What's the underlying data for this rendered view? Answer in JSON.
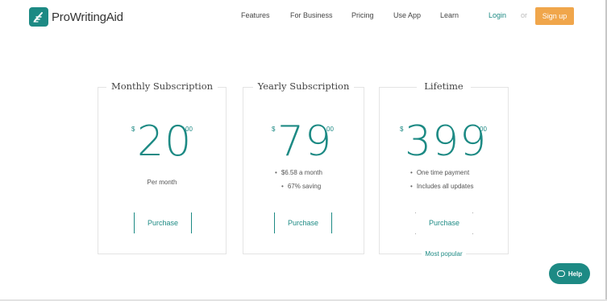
{
  "header": {
    "brand": "ProWritingAid",
    "nav": [
      "Features",
      "For Business",
      "Pricing",
      "Use App",
      "Learn"
    ],
    "login": "Login",
    "or": "or",
    "signup": "Sign up"
  },
  "plans": [
    {
      "title": "Monthly Subscription",
      "currency": "$",
      "amount": "20",
      "cents": "00",
      "per": "Per month",
      "bullets": [],
      "purchase": "Purchase",
      "badge": ""
    },
    {
      "title": "Yearly Subscription",
      "currency": "$",
      "amount": "79",
      "cents": "00",
      "per": "",
      "bullets": [
        "$6.58 a month",
        "67% saving"
      ],
      "purchase": "Purchase",
      "badge": ""
    },
    {
      "title": "Lifetime",
      "currency": "$",
      "amount": "399",
      "cents": "00",
      "per": "",
      "bullets": [
        "One time payment",
        "Includes all updates"
      ],
      "purchase": "Purchase",
      "badge": "Most popular"
    }
  ],
  "help": {
    "label": "Help"
  },
  "colors": {
    "accent": "#1d8a84",
    "signup": "#f0a64b"
  },
  "icons": {
    "logo": "prowritingaid-logo-icon",
    "help": "chat-bubble-icon"
  }
}
